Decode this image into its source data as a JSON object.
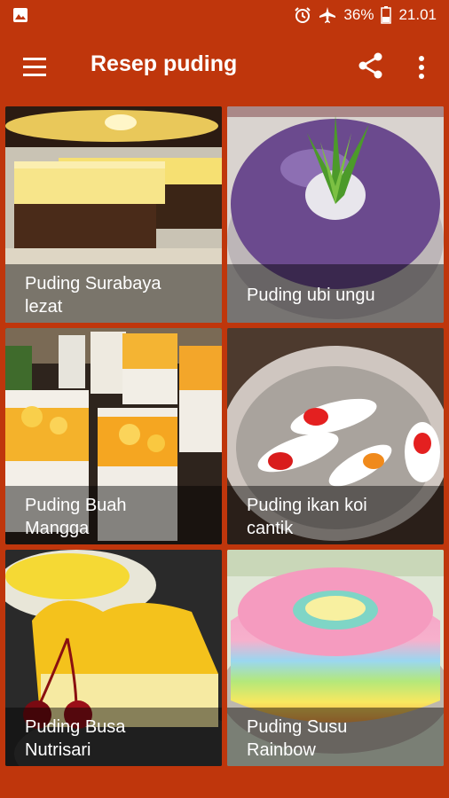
{
  "status_bar": {
    "battery_percent": "36%",
    "time": "21.01",
    "icons": [
      "image-icon",
      "alarm-icon",
      "airplane-icon",
      "battery-icon"
    ]
  },
  "app_bar": {
    "title": "Resep puding",
    "icons": [
      "menu-icon",
      "share-icon",
      "more-vert-icon"
    ]
  },
  "recipes": [
    {
      "line1": "Puding Surabaya",
      "line2": "lezat"
    },
    {
      "line1": "Puding ubi ungu",
      "line2": ""
    },
    {
      "line1": "Puding Buah",
      "line2": "Mangga"
    },
    {
      "line1": "Puding ikan koi",
      "line2": "cantik"
    },
    {
      "line1": "Puding Busa",
      "line2": "Nutrisari"
    },
    {
      "line1": "Puding Susu",
      "line2": "Rainbow"
    }
  ],
  "colors": {
    "primary": "#BF360C"
  }
}
